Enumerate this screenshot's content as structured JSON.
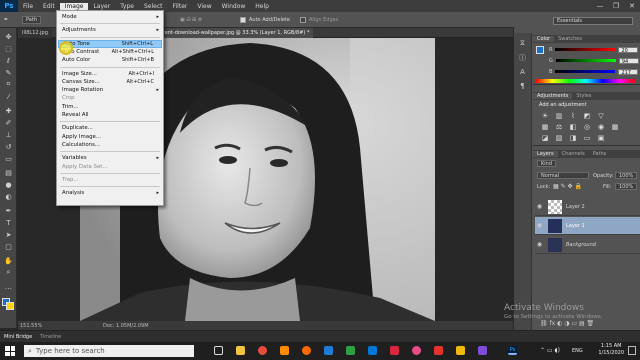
{
  "menubar": {
    "logo": "Ps",
    "items": [
      "File",
      "Edit",
      "Image",
      "Layer",
      "Type",
      "Select",
      "Filter",
      "View",
      "Window",
      "Help"
    ],
    "active_index": 2,
    "window_controls": [
      "—",
      "❐",
      "✕"
    ]
  },
  "options": {
    "path_select": "Path",
    "auto_add_delete": "Auto Add/Delete",
    "align_edges": "Align Edges"
  },
  "tabs": [
    {
      "label": "Ill8L12.jpg"
    },
    {
      "label": "cent-download-wallpaper.jpg @ 33.3% (Layer 1, RGB/8#) *"
    }
  ],
  "image_menu": {
    "items": [
      {
        "label": "Mode",
        "shortcut": "",
        "submenu": true,
        "disabled": false
      },
      {
        "sep": true
      },
      {
        "label": "Adjustments",
        "shortcut": "",
        "submenu": true,
        "disabled": false
      },
      {
        "sep": true
      },
      {
        "label": "Auto Tone",
        "shortcut": "Shift+Ctrl+L",
        "submenu": false,
        "disabled": false,
        "highlight": true
      },
      {
        "label": "Auto Contrast",
        "shortcut": "Alt+Shift+Ctrl+L",
        "submenu": false,
        "disabled": false
      },
      {
        "label": "Auto Color",
        "shortcut": "Shift+Ctrl+B",
        "submenu": false,
        "disabled": false
      },
      {
        "sep": true
      },
      {
        "label": "Image Size...",
        "shortcut": "Alt+Ctrl+I",
        "submenu": false,
        "disabled": false
      },
      {
        "label": "Canvas Size...",
        "shortcut": "Alt+Ctrl+C",
        "submenu": false,
        "disabled": false
      },
      {
        "label": "Image Rotation",
        "shortcut": "",
        "submenu": true,
        "disabled": false
      },
      {
        "label": "Crop",
        "shortcut": "",
        "submenu": false,
        "disabled": true
      },
      {
        "label": "Trim...",
        "shortcut": "",
        "submenu": false,
        "disabled": false
      },
      {
        "label": "Reveal All",
        "shortcut": "",
        "submenu": false,
        "disabled": false
      },
      {
        "sep": true
      },
      {
        "label": "Duplicate...",
        "shortcut": "",
        "submenu": false,
        "disabled": false
      },
      {
        "label": "Apply Image...",
        "shortcut": "",
        "submenu": false,
        "disabled": false
      },
      {
        "label": "Calculations...",
        "shortcut": "",
        "submenu": false,
        "disabled": false
      },
      {
        "sep": true
      },
      {
        "label": "Variables",
        "shortcut": "",
        "submenu": true,
        "disabled": false
      },
      {
        "label": "Apply Data Set...",
        "shortcut": "",
        "submenu": false,
        "disabled": true
      },
      {
        "sep": true
      },
      {
        "label": "Trap...",
        "shortcut": "",
        "submenu": false,
        "disabled": true
      },
      {
        "sep": true
      },
      {
        "label": "Analysis",
        "shortcut": "",
        "submenu": true,
        "disabled": false
      }
    ]
  },
  "status": {
    "zoom": "151.55%",
    "doc": "Doc: 1.05M/2.09M"
  },
  "timeline": {
    "tabs": [
      "Mini Bridge",
      "Timeline"
    ]
  },
  "panels": {
    "workspace": "Essentials",
    "color_tabs": [
      "Color",
      "Swatches"
    ],
    "color_values": [
      "20",
      "94",
      "217"
    ],
    "adjust_tabs": [
      "Adjustments",
      "Styles"
    ],
    "add_adjustment": "Add an adjustment",
    "layers_tabs": [
      "Layers",
      "Channels",
      "Paths"
    ],
    "kind": "Kind",
    "blend": "Normal",
    "opacity_label": "Opacity:",
    "opacity": "100%",
    "lock_label": "Lock:",
    "fill_label": "Fill:",
    "fill": "100%",
    "layers": [
      {
        "name": "Layer 2",
        "selected": false
      },
      {
        "name": "Layer 1",
        "selected": true
      },
      {
        "name": "Background",
        "selected": false
      }
    ]
  },
  "watermark": {
    "line1": "Activate Windows",
    "line2": "Go to Settings to activate Windows."
  },
  "taskbar": {
    "search_placeholder": "Type here to search",
    "lang": "ENG",
    "time": "1:15 AM",
    "date": "1/15/2020"
  },
  "colors": {
    "accent": "#1473e6",
    "fg_swatch": "#1d6fc8",
    "bg_swatch": "#ffd200",
    "menu_highlight": "#91c9f7"
  }
}
